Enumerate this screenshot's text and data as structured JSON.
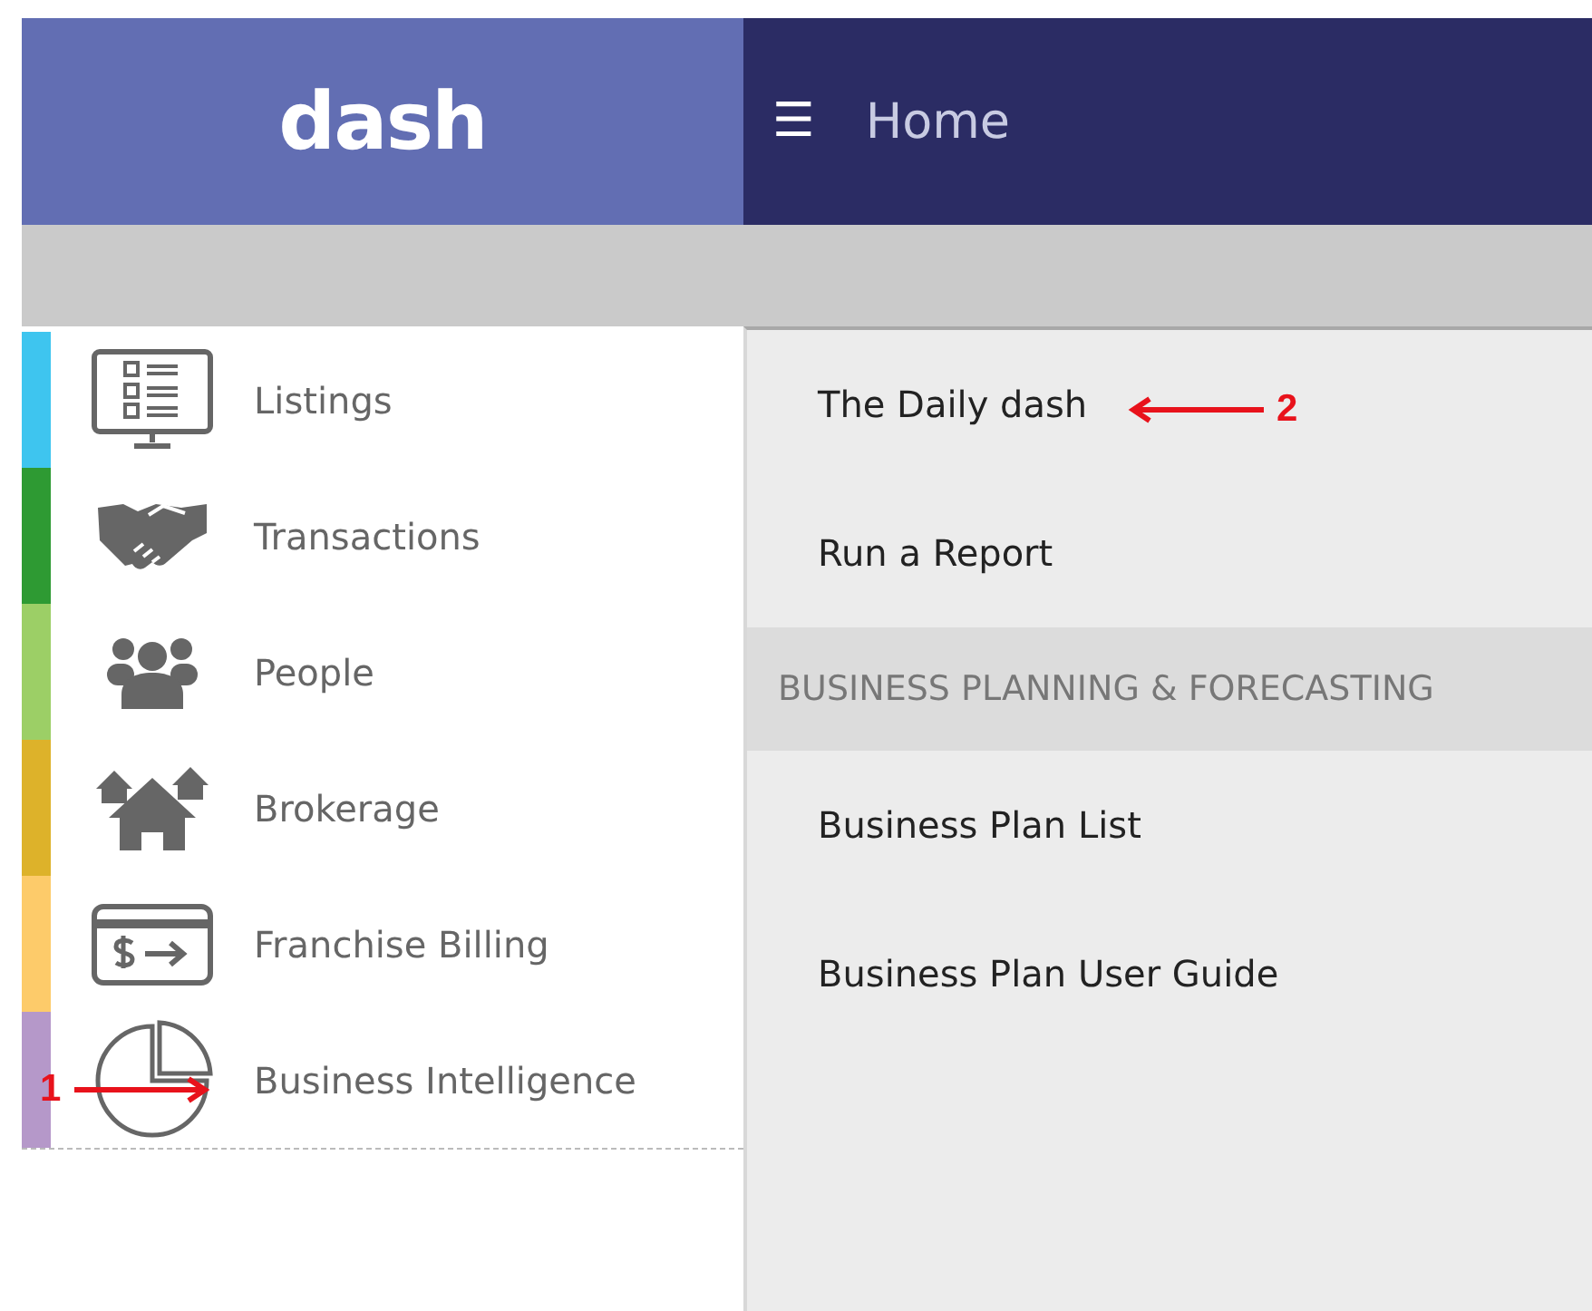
{
  "header": {
    "logo": "dash",
    "menu_glyph": "☰",
    "title": "Home"
  },
  "sidebar": {
    "items": [
      {
        "label": "Listings",
        "color": "#3ec5ef"
      },
      {
        "label": "Transactions",
        "color": "#2e9a33"
      },
      {
        "label": "People",
        "color": "#9ccf66"
      },
      {
        "label": "Brokerage",
        "color": "#ddb22a"
      },
      {
        "label": "Franchise Billing",
        "color": "#fdcb6a"
      },
      {
        "label": "Business Intelligence",
        "color": "#b598c9"
      }
    ]
  },
  "menu": {
    "items": [
      {
        "kind": "link",
        "label": "The Daily dash"
      },
      {
        "kind": "link",
        "label": "Run a Report"
      },
      {
        "kind": "heading",
        "label": "BUSINESS PLANNING & FORECASTING"
      },
      {
        "kind": "link",
        "label": "Business Plan List"
      },
      {
        "kind": "link",
        "label": "Business Plan User Guide"
      }
    ]
  },
  "annotations": [
    {
      "label": "1",
      "kind": "arrow-right"
    },
    {
      "label": "2",
      "kind": "arrow-left"
    }
  ]
}
